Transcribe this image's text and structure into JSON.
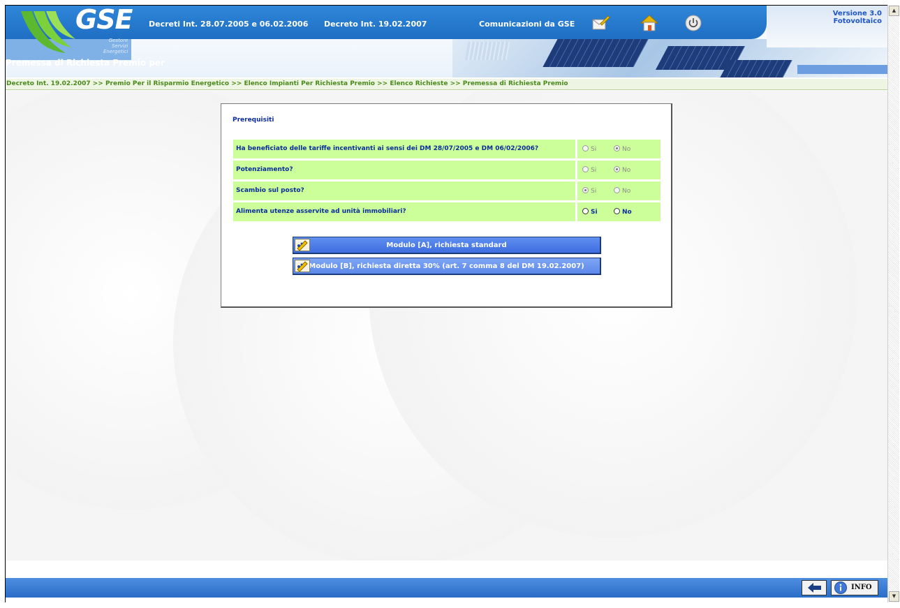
{
  "header": {
    "logo_text": "GSE",
    "logo_sub": [
      "Gestore",
      "Servizi",
      "Energetici"
    ],
    "nav": [
      {
        "label": "Decreti Int. 28.07.2005 e 06.02.2006"
      },
      {
        "label": "Decreto Int. 19.02.2007"
      },
      {
        "label": "Comunicazioni da GSE"
      }
    ],
    "icons": [
      "edit-icon",
      "home-icon",
      "power-icon"
    ],
    "version_line1": "Versione 3.0",
    "version_line2": "Fotovoltaico",
    "page_title": "Premessa di Richiesta Premio per"
  },
  "breadcrumb": "Decreto Int. 19.02.2007 >> Premio Per il Risparmio Energetico >> Elenco Impianti Per Richiesta Premio >> Elenco Richieste >> Premessa di Richiesta Premio",
  "card": {
    "heading": "Prerequisiti",
    "questions": [
      {
        "text": "Ha beneficiato delle tariffe incentivanti ai sensi dei DM 28/07/2005 e DM 06/02/2006?",
        "yes": "Si",
        "no": "No",
        "selected": "No",
        "enabled": false
      },
      {
        "text": "Potenziamento?",
        "yes": "Si",
        "no": "No",
        "selected": "No",
        "enabled": false
      },
      {
        "text": "Scambio sul posto?",
        "yes": "Si",
        "no": "No",
        "selected": "Si",
        "enabled": false
      },
      {
        "text": "Alimenta utenze asservite ad unità immobiliari?",
        "yes": "Si",
        "no": "No",
        "selected": null,
        "enabled": true
      }
    ],
    "buttons": [
      {
        "label": "Modulo [A], richiesta standard"
      },
      {
        "label": "Modulo [B], richiesta diretta 30% (art. 7 comma 8 del DM 19.02.2007)"
      }
    ]
  },
  "footer": {
    "info_label": "INFO"
  },
  "colors": {
    "header_blue": "#2f86d8",
    "question_bg": "#ccff99",
    "question_text": "#0a2c9c",
    "breadcrumb_text": "#4a8a1c"
  }
}
